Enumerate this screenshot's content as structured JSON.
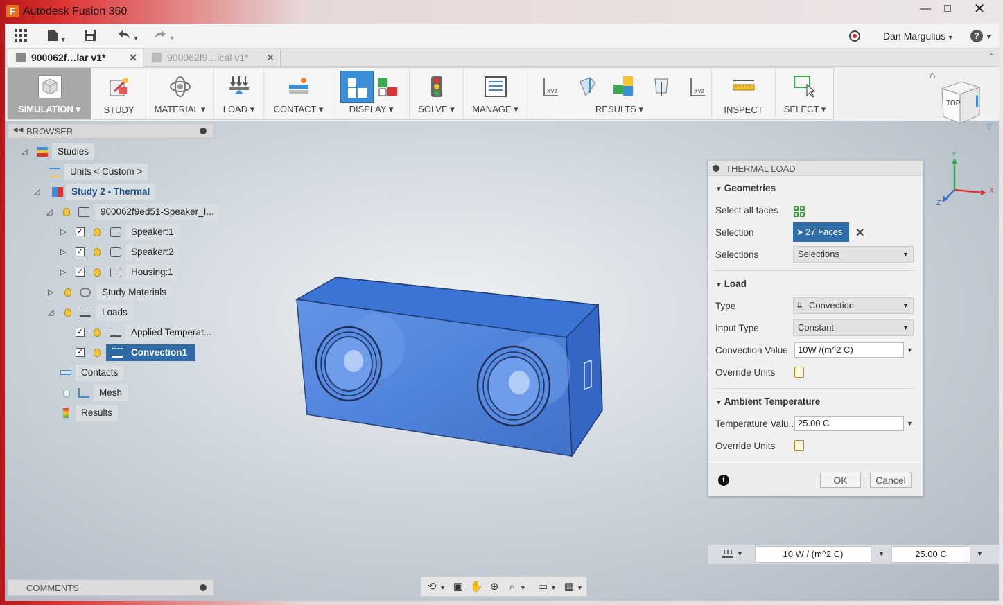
{
  "window": {
    "title": "Autodesk Fusion 360",
    "app_icon_letter": "F",
    "minimize": "—",
    "maximize": "□",
    "close": "✕"
  },
  "qat": {
    "user": "Dan Margulius",
    "help": "?"
  },
  "tabs": [
    {
      "label": "900062f…lar v1*"
    },
    {
      "label": "900062f9…ical v1*"
    }
  ],
  "ribbon": {
    "groups": [
      {
        "label": "SIMULATION ▾"
      },
      {
        "label": "STUDY"
      },
      {
        "label": "MATERIAL ▾"
      },
      {
        "label": "LOAD ▾"
      },
      {
        "label": "CONTACT ▾"
      },
      {
        "label": "DISPLAY ▾"
      },
      {
        "label": "SOLVE ▾"
      },
      {
        "label": "MANAGE ▾"
      },
      {
        "label": "RESULTS ▾"
      },
      {
        "label": "INSPECT"
      },
      {
        "label": "SELECT ▾"
      }
    ]
  },
  "browser": {
    "title": "BROWSER",
    "items": {
      "studies": "Studies",
      "units": "Units < Custom >",
      "study2": "Study 2 - Thermal",
      "component": "900062f9ed51-Speaker_I...",
      "speaker1": "Speaker:1",
      "speaker2": "Speaker:2",
      "housing1": "Housing:1",
      "study_materials": "Study Materials",
      "loads": "Loads",
      "applied_temp": "Applied Temperat...",
      "convection1": "Convection1",
      "contacts": "Contacts",
      "mesh": "Mesh",
      "results": "Results"
    }
  },
  "comments": {
    "title": "COMMENTS"
  },
  "dialog": {
    "title": "THERMAL LOAD",
    "geometries": {
      "heading": "Geometries",
      "select_all_faces_label": "Select all faces",
      "selection_label": "Selection",
      "selection_value": "27 Faces",
      "selections_label": "Selections",
      "selections_value": "Selections"
    },
    "load": {
      "heading": "Load",
      "type_label": "Type",
      "type_value": "Convection",
      "input_type_label": "Input Type",
      "input_type_value": "Constant",
      "convection_value_label": "Convection Value",
      "convection_value": "10W /(m^2 C)",
      "override_units_label": "Override Units"
    },
    "ambient": {
      "heading": "Ambient Temperature",
      "temperature_label": "Temperature Valu...",
      "temperature_value": "25.00 C",
      "override_units_label": "Override Units"
    },
    "ok": "OK",
    "cancel": "Cancel"
  },
  "status": {
    "convection": "10 W / (m^2 C)",
    "temperature": "25.00 C"
  },
  "viewcube": {
    "face": "TOP",
    "axis_x": "X",
    "axis_y": "Y",
    "axis_z": "Z"
  },
  "colors": {
    "accent_blue": "#2f6ea9",
    "model_blue": "#3d73d4",
    "selection_highlight": "#2e6aa6"
  }
}
